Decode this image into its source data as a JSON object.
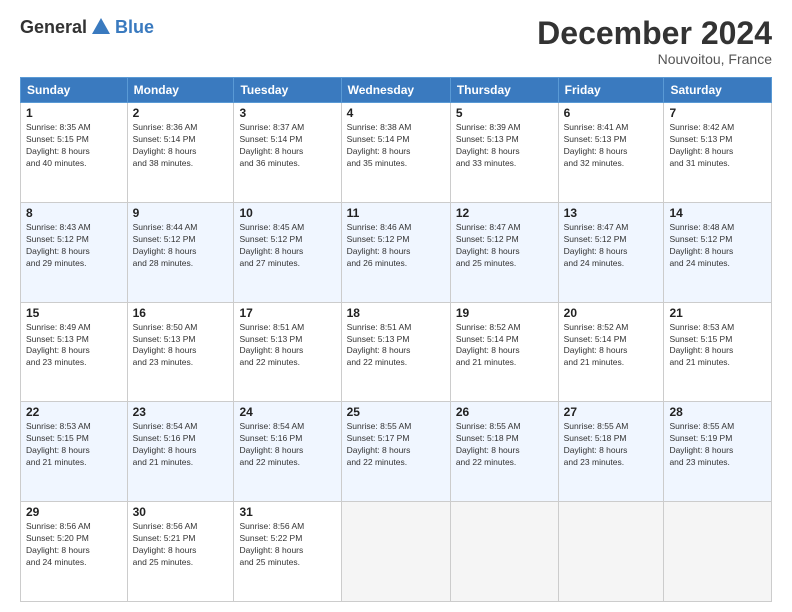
{
  "header": {
    "logo_general": "General",
    "logo_blue": "Blue",
    "month_title": "December 2024",
    "location": "Nouvoitou, France"
  },
  "days_of_week": [
    "Sunday",
    "Monday",
    "Tuesday",
    "Wednesday",
    "Thursday",
    "Friday",
    "Saturday"
  ],
  "weeks": [
    [
      {
        "day": "1",
        "sunrise": "8:35 AM",
        "sunset": "5:15 PM",
        "daylight": "8 hours and 40 minutes."
      },
      {
        "day": "2",
        "sunrise": "8:36 AM",
        "sunset": "5:14 PM",
        "daylight": "8 hours and 38 minutes."
      },
      {
        "day": "3",
        "sunrise": "8:37 AM",
        "sunset": "5:14 PM",
        "daylight": "8 hours and 36 minutes."
      },
      {
        "day": "4",
        "sunrise": "8:38 AM",
        "sunset": "5:14 PM",
        "daylight": "8 hours and 35 minutes."
      },
      {
        "day": "5",
        "sunrise": "8:39 AM",
        "sunset": "5:13 PM",
        "daylight": "8 hours and 33 minutes."
      },
      {
        "day": "6",
        "sunrise": "8:41 AM",
        "sunset": "5:13 PM",
        "daylight": "8 hours and 32 minutes."
      },
      {
        "day": "7",
        "sunrise": "8:42 AM",
        "sunset": "5:13 PM",
        "daylight": "8 hours and 31 minutes."
      }
    ],
    [
      {
        "day": "8",
        "sunrise": "8:43 AM",
        "sunset": "5:12 PM",
        "daylight": "8 hours and 29 minutes."
      },
      {
        "day": "9",
        "sunrise": "8:44 AM",
        "sunset": "5:12 PM",
        "daylight": "8 hours and 28 minutes."
      },
      {
        "day": "10",
        "sunrise": "8:45 AM",
        "sunset": "5:12 PM",
        "daylight": "8 hours and 27 minutes."
      },
      {
        "day": "11",
        "sunrise": "8:46 AM",
        "sunset": "5:12 PM",
        "daylight": "8 hours and 26 minutes."
      },
      {
        "day": "12",
        "sunrise": "8:47 AM",
        "sunset": "5:12 PM",
        "daylight": "8 hours and 25 minutes."
      },
      {
        "day": "13",
        "sunrise": "8:47 AM",
        "sunset": "5:12 PM",
        "daylight": "8 hours and 24 minutes."
      },
      {
        "day": "14",
        "sunrise": "8:48 AM",
        "sunset": "5:12 PM",
        "daylight": "8 hours and 24 minutes."
      }
    ],
    [
      {
        "day": "15",
        "sunrise": "8:49 AM",
        "sunset": "5:13 PM",
        "daylight": "8 hours and 23 minutes."
      },
      {
        "day": "16",
        "sunrise": "8:50 AM",
        "sunset": "5:13 PM",
        "daylight": "8 hours and 23 minutes."
      },
      {
        "day": "17",
        "sunrise": "8:51 AM",
        "sunset": "5:13 PM",
        "daylight": "8 hours and 22 minutes."
      },
      {
        "day": "18",
        "sunrise": "8:51 AM",
        "sunset": "5:13 PM",
        "daylight": "8 hours and 22 minutes."
      },
      {
        "day": "19",
        "sunrise": "8:52 AM",
        "sunset": "5:14 PM",
        "daylight": "8 hours and 21 minutes."
      },
      {
        "day": "20",
        "sunrise": "8:52 AM",
        "sunset": "5:14 PM",
        "daylight": "8 hours and 21 minutes."
      },
      {
        "day": "21",
        "sunrise": "8:53 AM",
        "sunset": "5:15 PM",
        "daylight": "8 hours and 21 minutes."
      }
    ],
    [
      {
        "day": "22",
        "sunrise": "8:53 AM",
        "sunset": "5:15 PM",
        "daylight": "8 hours and 21 minutes."
      },
      {
        "day": "23",
        "sunrise": "8:54 AM",
        "sunset": "5:16 PM",
        "daylight": "8 hours and 21 minutes."
      },
      {
        "day": "24",
        "sunrise": "8:54 AM",
        "sunset": "5:16 PM",
        "daylight": "8 hours and 22 minutes."
      },
      {
        "day": "25",
        "sunrise": "8:55 AM",
        "sunset": "5:17 PM",
        "daylight": "8 hours and 22 minutes."
      },
      {
        "day": "26",
        "sunrise": "8:55 AM",
        "sunset": "5:18 PM",
        "daylight": "8 hours and 22 minutes."
      },
      {
        "day": "27",
        "sunrise": "8:55 AM",
        "sunset": "5:18 PM",
        "daylight": "8 hours and 23 minutes."
      },
      {
        "day": "28",
        "sunrise": "8:55 AM",
        "sunset": "5:19 PM",
        "daylight": "8 hours and 23 minutes."
      }
    ],
    [
      {
        "day": "29",
        "sunrise": "8:56 AM",
        "sunset": "5:20 PM",
        "daylight": "8 hours and 24 minutes."
      },
      {
        "day": "30",
        "sunrise": "8:56 AM",
        "sunset": "5:21 PM",
        "daylight": "8 hours and 25 minutes."
      },
      {
        "day": "31",
        "sunrise": "8:56 AM",
        "sunset": "5:22 PM",
        "daylight": "8 hours and 25 minutes."
      },
      null,
      null,
      null,
      null
    ]
  ]
}
